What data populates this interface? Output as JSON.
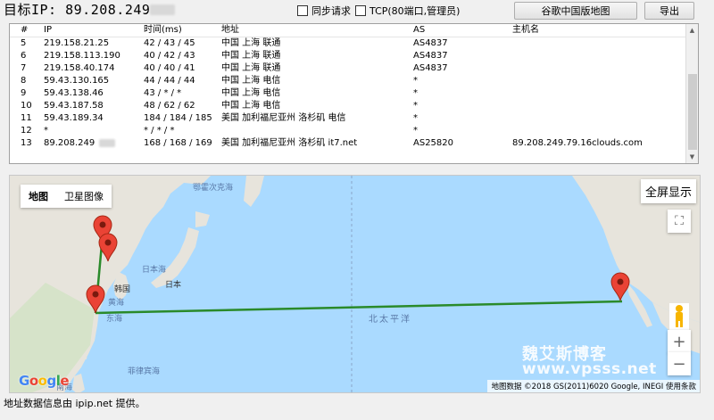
{
  "header": {
    "target_label": "目标IP:  89.208.249",
    "sync_label": "同步请求",
    "tcp_label": "TCP(80端口,管理员)",
    "china_map_button": "谷歌中国版地图",
    "export_button": "导出"
  },
  "table": {
    "columns": [
      "#",
      "IP",
      "时间(ms)",
      "地址",
      "AS",
      "主机名"
    ],
    "rows": [
      [
        "5",
        "219.158.21.25",
        "42 / 43 / 45",
        "中国 上海 联通",
        "AS4837",
        ""
      ],
      [
        "6",
        "219.158.113.190",
        "40 / 42 / 43",
        "中国 上海 联通",
        "AS4837",
        ""
      ],
      [
        "7",
        "219.158.40.174",
        "40 / 40 / 41",
        "中国 上海 联通",
        "AS4837",
        ""
      ],
      [
        "8",
        "59.43.130.165",
        "44 / 44 / 44",
        "中国 上海 电信",
        "*",
        ""
      ],
      [
        "9",
        "59.43.138.46",
        "43 / * / *",
        "中国 上海 电信",
        "*",
        ""
      ],
      [
        "10",
        "59.43.187.58",
        "48 / 62 / 62",
        "中国 上海 电信",
        "*",
        ""
      ],
      [
        "11",
        "59.43.189.34",
        "184 / 184 / 185",
        "美国 加利福尼亚州 洛杉矶 电信",
        "*",
        ""
      ],
      [
        "12",
        "*",
        "* / * / *",
        "",
        "*",
        ""
      ],
      [
        "13",
        "89.208.249",
        "168 / 168 / 169",
        "美国 加利福尼亚州 洛杉矶 it7.net",
        "AS25820",
        "89.208.249.79.16clouds.com"
      ]
    ]
  },
  "map": {
    "type_map": "地图",
    "type_satellite": "卫星图像",
    "fullscreen": "全屏显示",
    "zoom_in": "+",
    "zoom_out": "−",
    "logo": "Google",
    "attribution": "地图数据 ©2018 GS(2011)6020 Google, INEGI   使用条款",
    "watermark_cn": "魏艾斯博客",
    "watermark_url": "www.vpsss.net",
    "labels": {
      "okhotsk": "鄂霍次克海",
      "japan_sea": "日本海",
      "japan": "日本",
      "korea": "韩国",
      "yellow_sea": "黄海",
      "east_sea": "东海",
      "pacific": "北太平洋",
      "philippine_sea": "菲律宾海",
      "nanhai": "南海"
    },
    "route_color": "#2a8a2a",
    "pin_color": "#ea4335"
  },
  "footer": {
    "source_text": "地址数据信息由 ipip.net 提供。"
  }
}
